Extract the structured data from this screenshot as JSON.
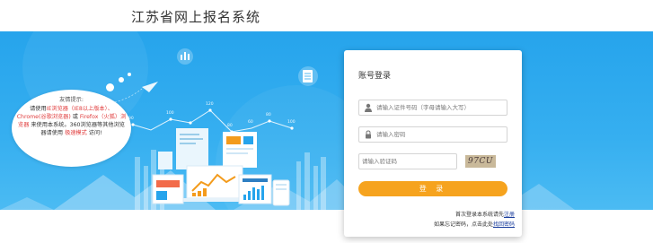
{
  "header": {
    "title": "江苏省网上报名系统"
  },
  "tip": {
    "title": "友情提示:",
    "l1a": "请使用",
    "l1b": "IE浏览器（IE8以上版本）",
    "l1c": "、",
    "l2a": "Chrome(谷歌浏览器)",
    "l2b": "或",
    "l2c": "Firefox（火狐）浏览器",
    "l2d": "来使用本系统。360浏览器等其他浏览器请使用",
    "l2e": "极速模式",
    "l2f": "访问!"
  },
  "chart_labels": [
    "90",
    "100",
    "120",
    "80",
    "60",
    "80",
    "100"
  ],
  "login": {
    "title": "账号登录",
    "id_placeholder": "请输入证件号码（字母请输入大写）",
    "password_placeholder": "请输入密码",
    "captcha_placeholder": "请输入验证码",
    "captcha_text": "97CU",
    "submit_label": "登 录",
    "register_prefix": "首次登录本系统请先",
    "register_link": "注册",
    "forgot_prefix": "如果忘记密码，点击此处",
    "forgot_link": "找回密码"
  },
  "colors": {
    "banner": "#2aa7ee",
    "accent": "#f6a31e",
    "tip_red": "#e03c3c",
    "link": "#1a3d9c"
  }
}
